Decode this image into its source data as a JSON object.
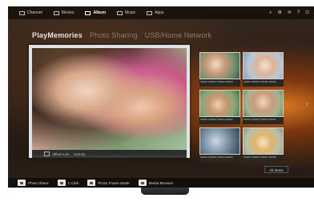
{
  "top_menu": {
    "items": [
      {
        "label": "Channel",
        "active": false
      },
      {
        "label": "Movies",
        "active": false
      },
      {
        "label": "Album",
        "active": true
      },
      {
        "label": "Music",
        "active": false
      },
      {
        "label": "Apps",
        "active": false
      }
    ],
    "status_icons": [
      "search-icon",
      "settings-icon",
      "wifi-icon",
      "help-icon",
      "power-icon"
    ]
  },
  "tabs": [
    {
      "label": "PlayMemories",
      "active": true
    },
    {
      "label": "Photo Sharing",
      "active": false
    },
    {
      "label": "USB/Home Network",
      "active": false
    }
  ],
  "featured": {
    "caption_icon": "photo-icon",
    "caption_primary": "Album List",
    "caption_secondary": "Sort by"
  },
  "thumbnails": [
    {
      "label": "xxxxx xxxxxx xxxxx xxxxx",
      "icon": "photo-thumb"
    },
    {
      "label": "xxxxx xxxxxx xxxxx xxxxx",
      "icon": "photo-thumb"
    },
    {
      "label": "xxxxx xxxxxx xxxxx xxxxx",
      "icon": "photo-thumb"
    },
    {
      "label": "xxxxx xxxxxx xxxxx xxxxx",
      "icon": "photo-thumb"
    },
    {
      "label": "xxxxx xxxxxx xxxxx xxxxx",
      "icon": "photo-thumb"
    },
    {
      "label": "xxxxx xxxxxx xxxxx xxxxx",
      "icon": "photo-thumb"
    }
  ],
  "view_all_label": "All Items",
  "bottom_bar": [
    {
      "label": "Photo Share",
      "icon": "photo-share-icon"
    },
    {
      "label": "1 Click",
      "icon": "one-click-icon"
    },
    {
      "label": "Photo Frame Mode",
      "icon": "photo-frame-icon"
    },
    {
      "label": "Media Browser",
      "icon": "media-browser-icon"
    }
  ],
  "colors": {
    "accent": "#e9e3dd",
    "background_dark": "#1f1711",
    "glow": "#ff8c28"
  }
}
